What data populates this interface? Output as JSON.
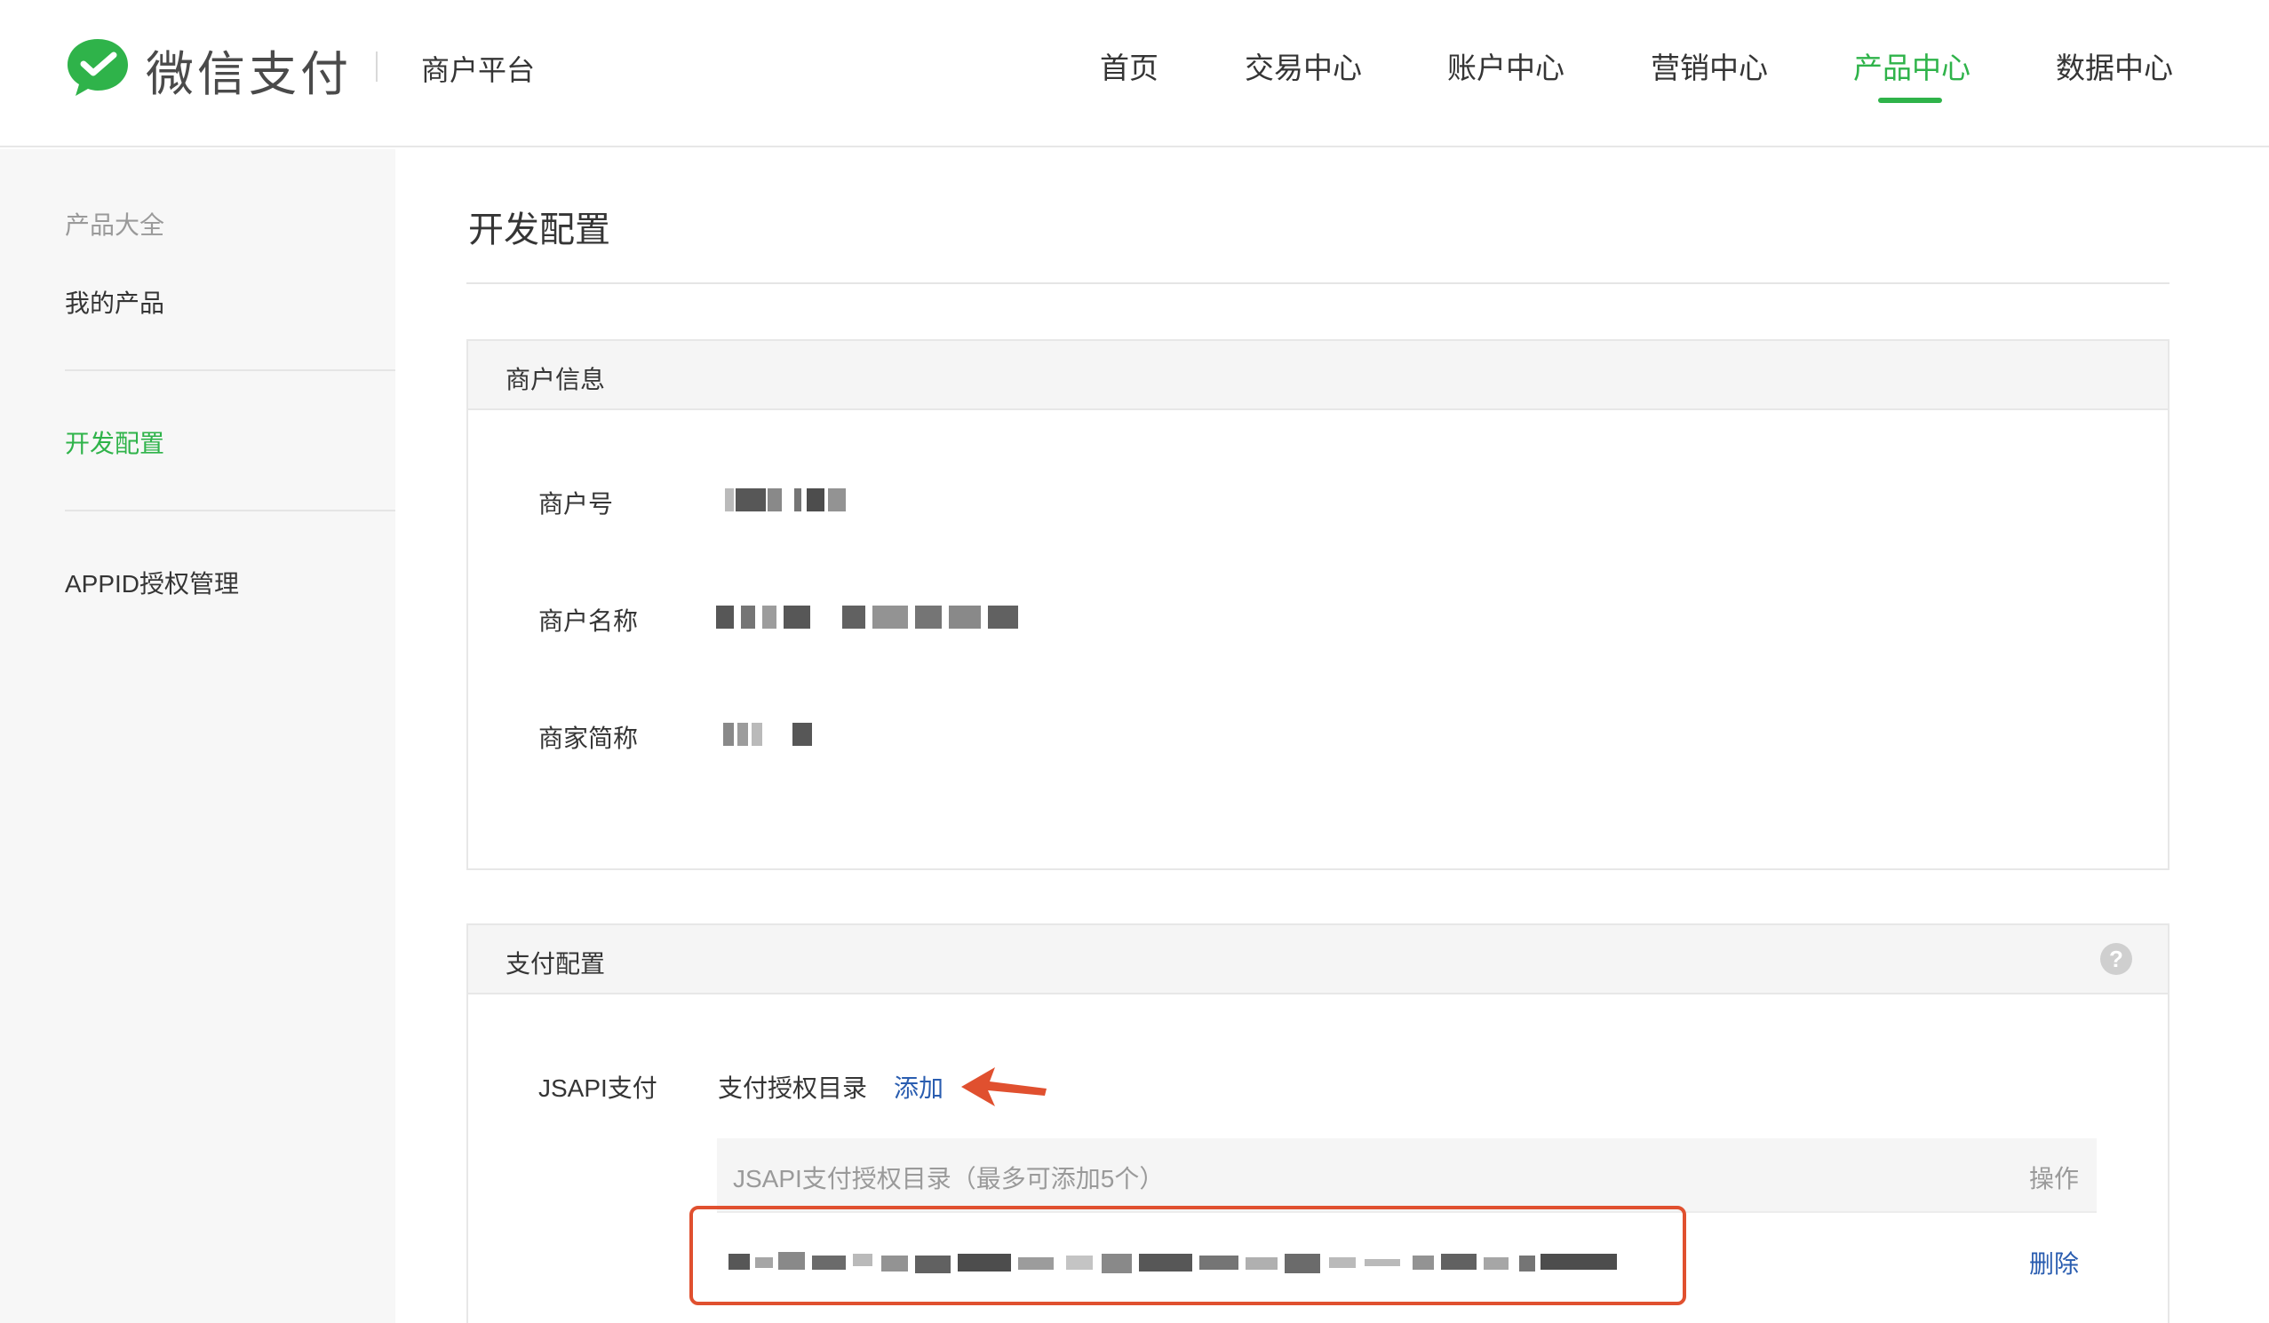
{
  "header": {
    "brand": "微信支付",
    "platform": "商户平台",
    "nav": [
      {
        "label": "首页",
        "active": false
      },
      {
        "label": "交易中心",
        "active": false
      },
      {
        "label": "账户中心",
        "active": false
      },
      {
        "label": "营销中心",
        "active": false
      },
      {
        "label": "产品中心",
        "active": true
      },
      {
        "label": "数据中心",
        "active": false
      }
    ]
  },
  "sidebar": {
    "items": [
      {
        "label": "产品大全",
        "state": "muted"
      },
      {
        "label": "我的产品",
        "state": "normal"
      },
      {
        "label": "开发配置",
        "state": "active"
      },
      {
        "label": "APPID授权管理",
        "state": "normal"
      }
    ]
  },
  "main": {
    "title": "开发配置",
    "merchant_panel": {
      "title": "商户信息",
      "fields": [
        {
          "label": "商户号",
          "value_redacted": true
        },
        {
          "label": "商户名称",
          "value_redacted": true
        },
        {
          "label": "商家简称",
          "value_redacted": true
        }
      ]
    },
    "payment_panel": {
      "title": "支付配置",
      "help_icon": "question-circle-icon",
      "jsapi_label": "JSAPI支付",
      "directory_label": "支付授权目录",
      "add_link": "添加",
      "table": {
        "header_left": "JSAPI支付授权目录（最多可添加5个）",
        "header_right": "操作",
        "rows": [
          {
            "url_redacted": true,
            "action": "删除"
          }
        ]
      }
    }
  },
  "colors": {
    "brand_green": "#2fb34a",
    "link_blue": "#2a5db0",
    "annotation_red": "#e0502f"
  }
}
